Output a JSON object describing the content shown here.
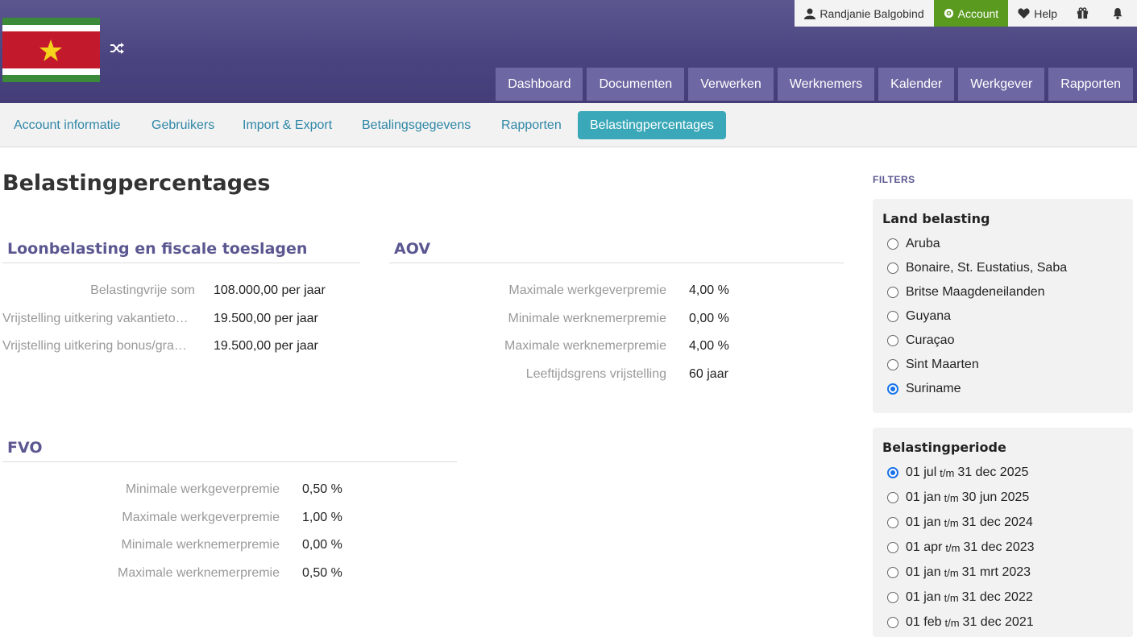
{
  "topbar": {
    "user": "Randjanie Balgobind",
    "account": "Account",
    "help": "Help",
    "icons": [
      "user-icon",
      "gear-icon",
      "heart-icon",
      "gift-icon",
      "bell-icon"
    ]
  },
  "mainnav": [
    "Dashboard",
    "Documenten",
    "Verwerken",
    "Werknemers",
    "Kalender",
    "Werkgever",
    "Rapporten"
  ],
  "subnav": [
    "Account informatie",
    "Gebruikers",
    "Import & Export",
    "Betalingsgegevens",
    "Rapporten",
    "Belastingpercentages"
  ],
  "page": {
    "title": "Belastingpercentages"
  },
  "loonbelasting": {
    "title": "Loonbelasting en fiscale toeslagen",
    "rows": [
      {
        "label": "Belastingvrije som",
        "value": "108.000,00 per jaar"
      },
      {
        "label": "Vrijstelling uitkering vakantietoelage",
        "value": "19.500,00 per jaar"
      },
      {
        "label": "Vrijstelling uitkering bonus/gratificatie",
        "value": "19.500,00 per jaar"
      }
    ]
  },
  "aov": {
    "title": "AOV",
    "rows": [
      {
        "label": "Maximale werkgeverpremie",
        "value": "4,00 %"
      },
      {
        "label": "Minimale werknemerpremie",
        "value": "0,00 %"
      },
      {
        "label": "Maximale werknemerpremie",
        "value": "4,00 %"
      },
      {
        "label": "Leeftijdsgrens vrijstelling",
        "value": "60 jaar"
      }
    ]
  },
  "fvo": {
    "title": "FVO",
    "rows": [
      {
        "label": "Minimale werkgeverpremie",
        "value": "0,50 %"
      },
      {
        "label": "Maximale werkgeverpremie",
        "value": "1,00 %"
      },
      {
        "label": "Minimale werknemerpremie",
        "value": "0,00 %"
      },
      {
        "label": "Maximale werknemerpremie",
        "value": "0,50 %"
      }
    ]
  },
  "filters": {
    "title": "FILTERS",
    "land": {
      "title": "Land belasting",
      "options": [
        "Aruba",
        "Bonaire, St. Eustatius, Saba",
        "Britse Maagdeneilanden",
        "Guyana",
        "Curaçao",
        "Sint Maarten",
        "Suriname"
      ],
      "selected": "Suriname"
    },
    "periode": {
      "title": "Belastingperiode",
      "tm": "t/m",
      "options": [
        {
          "from": "01 jul",
          "to": "31 dec 2025"
        },
        {
          "from": "01 jan",
          "to": "30 jun 2025"
        },
        {
          "from": "01 jan",
          "to": "31 dec 2024"
        },
        {
          "from": "01 apr",
          "to": "31 dec 2023"
        },
        {
          "from": "01 jan",
          "to": "31 mrt 2023"
        },
        {
          "from": "01 jan",
          "to": "31 dec 2022"
        },
        {
          "from": "01 feb",
          "to": "31 dec 2021"
        }
      ],
      "selected_index": 0
    }
  }
}
